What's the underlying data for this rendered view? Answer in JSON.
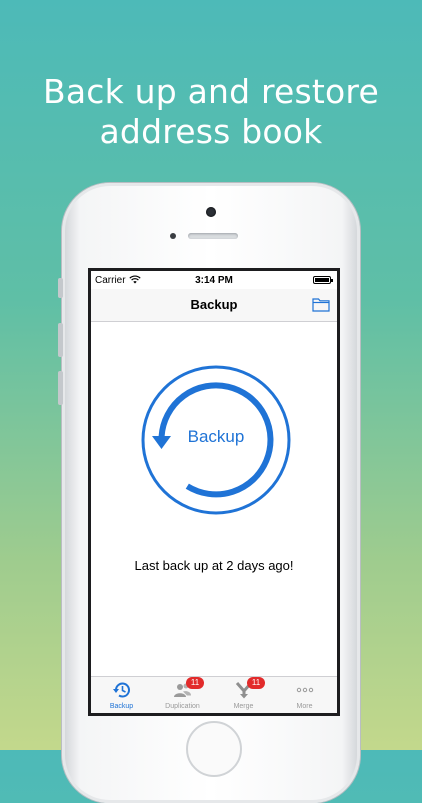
{
  "headline": {
    "line1": "Back up and restore",
    "line2": "address book"
  },
  "status_bar": {
    "carrier": "Carrier",
    "time": "3:14 PM"
  },
  "nav": {
    "title": "Backup"
  },
  "backup_button": {
    "label": "Backup",
    "accent_color": "#1f73d6"
  },
  "status_message": "Last back up at 2 days ago!",
  "tabs": [
    {
      "label": "Backup",
      "icon": "backup-clock-icon",
      "badge": null,
      "active": true
    },
    {
      "label": "Duplication",
      "icon": "people-icon",
      "badge": "11",
      "active": false
    },
    {
      "label": "Merge",
      "icon": "merge-arrow-icon",
      "badge": "11",
      "active": false
    },
    {
      "label": "More",
      "icon": "more-dots-icon",
      "badge": null,
      "active": false
    }
  ]
}
